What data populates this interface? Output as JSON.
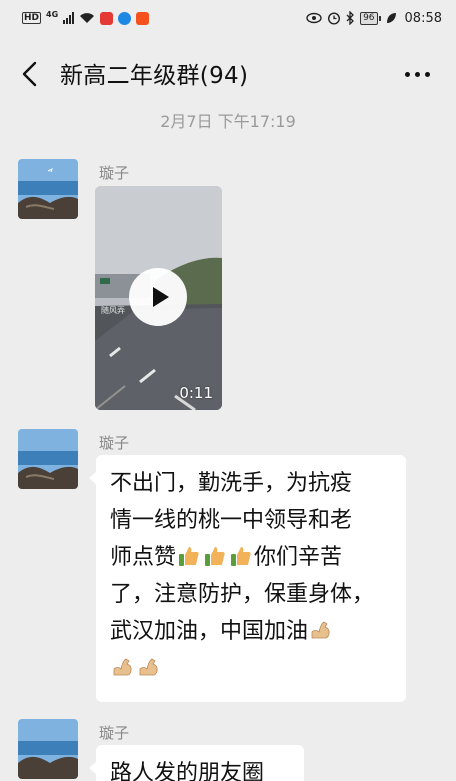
{
  "status_bar": {
    "hd": "HD",
    "network": "4G",
    "battery": "96",
    "time": "08:58"
  },
  "header": {
    "title": "新高二年级群(94)"
  },
  "timestamp": "2月7日 下午17:19",
  "messages": [
    {
      "sender": "璇子",
      "type": "video",
      "duration": "0:11",
      "overlay": "随风弄"
    },
    {
      "sender": "璇子",
      "type": "text",
      "lines": [
        "不出门，勤洗手，为抗疫",
        "情一线的桃一中领导和老",
        "师点赞",
        "你们辛苦",
        "了，注意防护，保重身体，",
        "武汉加油，中国加油"
      ]
    },
    {
      "sender": "璇子",
      "type": "text",
      "lines": [
        "路人发的朋友圈"
      ]
    }
  ],
  "colors": {
    "background": "#ededed",
    "bubble": "#ffffff",
    "sender_text": "#888888",
    "timestamp_text": "#9a9a9a"
  },
  "icons": [
    "back-arrow-icon",
    "more-dots-icon",
    "play-icon",
    "thumbs-up-emoji",
    "flexed-biceps-emoji"
  ]
}
